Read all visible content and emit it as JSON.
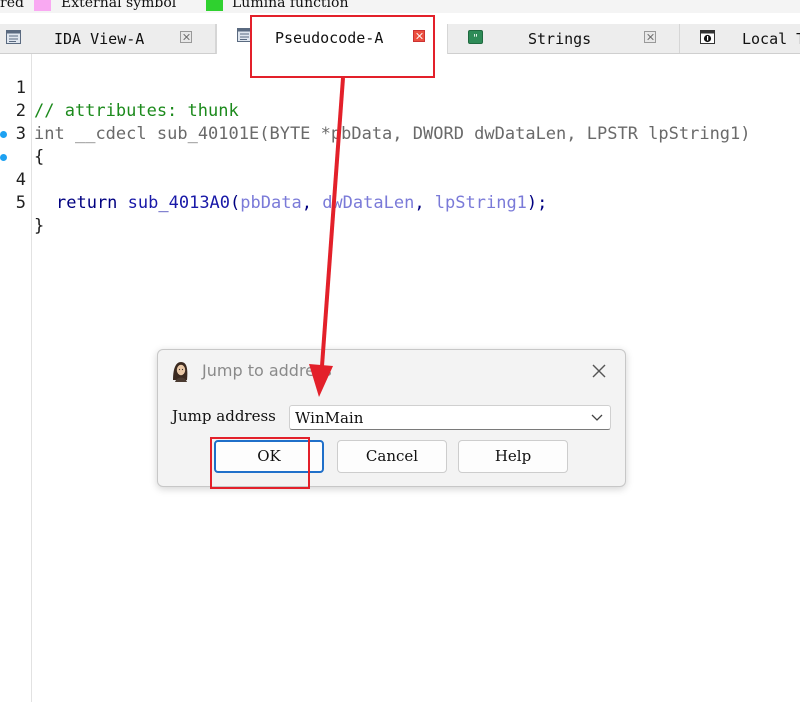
{
  "legend": {
    "items": [
      {
        "label": "red",
        "color": ""
      },
      {
        "label": "External symbol",
        "color": "#f9a9f2"
      },
      {
        "label": "Lumina function",
        "color": "#2fd12f"
      }
    ]
  },
  "tabs": [
    {
      "label": "IDA View-A",
      "icon": "text-view-icon",
      "active": false
    },
    {
      "label": "Pseudocode-A",
      "icon": "pseudocode-icon",
      "active": true
    },
    {
      "label": "Strings",
      "icon": "strings-icon",
      "active": false
    },
    {
      "label": "Local T",
      "icon": "local-types-icon",
      "active": false
    }
  ],
  "code": {
    "line_numbers": [
      "1",
      "2",
      "3",
      "4",
      "5"
    ],
    "line1": "// attributes: thunk",
    "line2": {
      "ret": "int",
      "conv": "__cdecl",
      "fn": "sub_40101E",
      "params": "(BYTE *pbData, DWORD dwDataLen, LPSTR lpString1)"
    },
    "line3": "{",
    "line4": {
      "kw": "return",
      "fn": "sub_4013A0",
      "open": "(",
      "arg1": "pbData",
      "sep1": ", ",
      "arg2": "dwDataLen",
      "sep2": ", ",
      "arg3": "lpString1",
      "close": ");"
    },
    "line5": "}"
  },
  "dialog": {
    "title": "Jump to address",
    "field_label": "Jump address",
    "field_value": "WinMain",
    "buttons": {
      "ok": "OK",
      "cancel": "Cancel",
      "help": "Help"
    }
  },
  "colors": {
    "annotation": "#e3202a",
    "breakpoint": "#1da1f2",
    "default_button_border": "#1f6fc9"
  }
}
